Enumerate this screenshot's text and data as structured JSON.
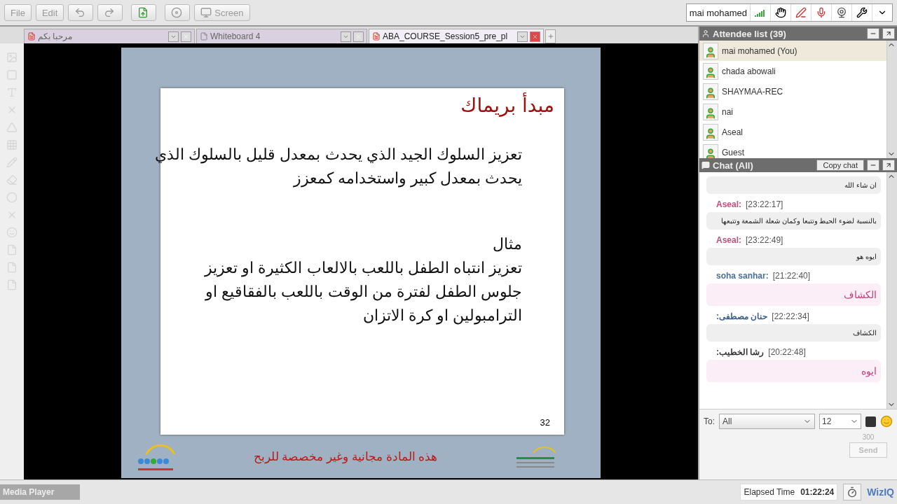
{
  "toolbar": {
    "file_button": "File",
    "edit_button": "Edit",
    "screen_button": "Screen"
  },
  "user_panel": {
    "name": "mai mohamed"
  },
  "tabs": {
    "welcome_tab": {
      "label": "مرحبا بكم",
      "kind": "doc",
      "selected": false
    },
    "whiteboard_tab": {
      "label": "Whiteboard 4",
      "kind": "board",
      "selected": false
    },
    "presentation_tab": {
      "label": "ABA_COURSE_Session5_pre_pl",
      "kind": "doc",
      "selected": true
    }
  },
  "slide": {
    "title": "مبدأ بريماك",
    "paragraphs": [
      [
        "تعزيز السلوك الجيد الذي يحدث بمعدل قليل بالسلوك الذي",
        "يحدث بمعدل كبير واستخدامه كمعزز"
      ],
      [
        "مثال",
        "تعزيز انتباه الطفل باللعب بالالعاب الكثيرة او تعزيز",
        "جلوس الطفل لفترة من الوقت باللعب بالفقاقيع او",
        "الترامبولين او كرة الاتزان"
      ]
    ],
    "page_number": "32",
    "footer": "هذه المادة مجانية وغير مخصصة للربح"
  },
  "attendees": {
    "title": "Attendee list (39)",
    "items": [
      {
        "name": "mai mohamed (You)",
        "selected": true
      },
      {
        "name": "chada abowali",
        "selected": false
      },
      {
        "name": "SHAYMAA-REC",
        "selected": false
      },
      {
        "name": "nai",
        "selected": false
      },
      {
        "name": "Aseal",
        "selected": false
      },
      {
        "name": "Guest",
        "selected": false
      }
    ]
  },
  "chat": {
    "title": "Chat (All)",
    "copy_button": "Copy chat",
    "messages": [
      {
        "text": "ان شاء الله",
        "highlighted": false
      },
      {
        "sender": "Aseal:",
        "color": "#c0507a",
        "time": "[23:22:17]",
        "text": "بالنسبة لضوء الحيط وتتبعا وكمان شعلة الشمعة وتتبعها",
        "highlighted": false
      },
      {
        "sender": "Aseal:",
        "color": "#c0507a",
        "time": "[23:22:49]",
        "text": "ايوه هو",
        "highlighted": false
      },
      {
        "sender": "soha sanhar:",
        "color": "#4a6f99",
        "time": "[21:22:40]",
        "text": "الكشاف",
        "highlighted": true
      },
      {
        "sender": "حنان مصطفى:",
        "color": "#3b5f8a",
        "time": "[22:22:34]",
        "text": "الكشاف",
        "highlighted": false
      },
      {
        "sender": "رشا الخطيب:",
        "color": "#333333",
        "time": "[20:22:48]",
        "text": "ايوه",
        "highlighted": true
      }
    ]
  },
  "compose": {
    "to_label": "To:",
    "recipient": "All",
    "font_size": "12",
    "char_count": "300",
    "send_button": "Send",
    "send_disabled": true
  },
  "footer": {
    "media_player": "Media Player",
    "elapsed_label": "Elapsed Time",
    "elapsed": "01:22:24",
    "brand": "WizIQ"
  }
}
